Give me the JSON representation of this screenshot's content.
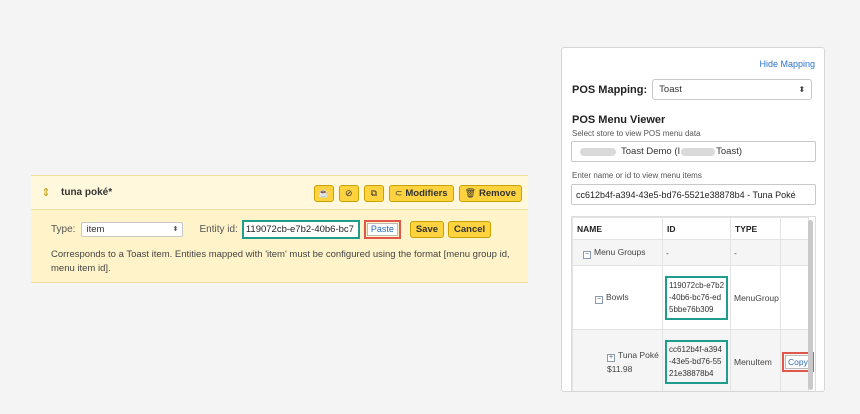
{
  "editor": {
    "drag_icon": "drag-handle-icon",
    "item_name": "tuna poké*",
    "actions": {
      "modifiers_label": "Modifiers",
      "remove_label": "Remove"
    },
    "type_label": "Type:",
    "type_value": "item",
    "entity_label": "Entity id:",
    "entity_value": "119072cb-e7b2-40b6-bc7",
    "paste_label": "Paste",
    "save_label": "Save",
    "cancel_label": "Cancel",
    "description": "Corresponds to a Toast item. Entities mapped with 'item' must be configured using the format [menu group id, menu item id]."
  },
  "panel": {
    "hide_mapping_label": "Hide Mapping",
    "pos_mapping_label": "POS Mapping:",
    "pos_value": "Toast",
    "viewer_title": "POS Menu Viewer",
    "viewer_subtitle": "Select store to view POS menu data",
    "store_value_a": "Toast Demo (I",
    "store_value_b": "Toast)",
    "search_label": "Enter name or id to view menu items",
    "search_value": "cc612b4f-a394-43e5-bd76-5521e38878b4 - Tuna Poké",
    "table": {
      "headers": {
        "name": "NAME",
        "id": "ID",
        "type": "TYPE"
      },
      "rows": [
        {
          "toggle": "−",
          "name": "Menu Groups",
          "id": "-",
          "type": "-"
        },
        {
          "toggle": "−",
          "name": "Bowls",
          "id": "119072cb-e7b2-40b6-bc76-ed5bbe76b309",
          "type": "MenuGroup"
        },
        {
          "toggle": "+",
          "name": "Tuna Poké",
          "price": "$11.98",
          "id": "cc612b4f-a394-43e5-bd76-5521e38878b4",
          "type": "MenuItem",
          "copy_label": "Copy"
        }
      ]
    }
  },
  "colors": {
    "highlight_teal": "#1e9c8e",
    "highlight_red": "#e0584c",
    "button_yellow": "#ffd23f",
    "editor_bg": "#fff3c9",
    "link_blue": "#2a74c9"
  }
}
